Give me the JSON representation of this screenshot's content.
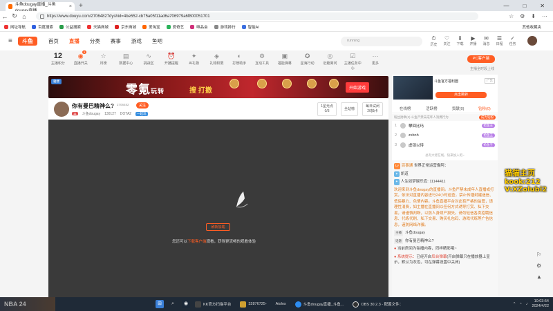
{
  "browser": {
    "tab_title": "斗鱼dougay直播_斗鱼dougay直播...",
    "url": "https://www.douyu.com/27064827dyshid=4be552-cb75a05f11ad6a706979a6f800051701",
    "bookmarks": [
      "网址导航",
      "百度搜索",
      "公益搜索",
      "天猫商城",
      "京东商城",
      "爱淘宝",
      "爱奇艺",
      "唯品会",
      "游戏排行",
      "智能AI"
    ],
    "other_bookmarks": "其他收藏夹"
  },
  "site": {
    "logo": "斗鱼",
    "nav": [
      "首页",
      "直播",
      "分类",
      "赛事",
      "游戏",
      "鱼吧"
    ],
    "search_placeholder": "running",
    "header_icons": [
      "历史",
      "关注",
      "下载",
      "开播",
      "消息",
      "日程",
      "任务"
    ],
    "header_icon_glyphs": [
      "⏱",
      "♡",
      "⬇",
      "▶",
      "✉",
      "☰",
      "✓"
    ]
  },
  "funcbar": {
    "level_num": "12",
    "level_label": "主播积分",
    "items": [
      "直播开关",
      "月榜",
      "数据中心",
      "挑战区",
      "开播提醒",
      "AI礼物",
      "礼物权限",
      "打榜助手",
      "互动工具",
      "福能弹幕",
      "星海行动",
      "近距离问",
      "主播任务中心",
      "更多"
    ],
    "item_glyphs": [
      "◉",
      "☆",
      "▤",
      "∿",
      "⏰",
      "✦",
      "◈",
      "◐",
      "⚙",
      "▣",
      "✪",
      "◎",
      "☑",
      "⋯"
    ],
    "badge": "3",
    "pc_button": "PC客户端",
    "pc_sub": "主播全时段上线"
  },
  "banner": {
    "tag": "雅楼",
    "big": "零氪",
    "mid": "玩转",
    "sub": "搜 打撤",
    "play": "开始游戏"
  },
  "room": {
    "title": "你有曼巴精神么?",
    "room_id": "2706482",
    "follow": "关注",
    "level": "11",
    "anchor": "斗鱼dougay",
    "fans": "130127",
    "game": "DOTA2",
    "category": "一起玩",
    "box1_top": "1星光点",
    "box1_bottom": "0/3",
    "box2": "全站榜",
    "box3_top": "每日试闭",
    "box3_bottom": "20抽卡"
  },
  "video": {
    "error_btn": "刷新加载",
    "tip_prefix": "您还可以",
    "tip_link": "下载客户端",
    "tip_suffix": "观看，获得更流畅的观看体验"
  },
  "sidebar": {
    "promo_title": "斗鱼官方福利圈",
    "promo_ad": "广告",
    "promo_btn": "点击跳转",
    "tabs": [
      "在线榜",
      "活跃榜",
      "贡献(0)",
      "钻粉(0)"
    ],
    "active_tab": 3,
    "rank_header": "粉丝勋章(3)  斗鱼严禁未成年人消费行为",
    "rank_header_btn": "成为钻粉",
    "ranks": [
      {
        "n": "1",
        "name": "攀回比玛",
        "tag": "抢鱼王"
      },
      {
        "n": "2",
        "name": "zxbnh",
        "tag": "抢鱼王"
      },
      {
        "n": "3",
        "name": "虚锁以待",
        "tag": "抢鱼王"
      }
    ],
    "more": "总有大佬在线，快来加入吧~",
    "chat": {
      "welcome_badge": "Lv",
      "welcome_user": "百事通",
      "welcome_text": "世界正常运营像阿：",
      "user2": "凯道",
      "msg3": "人生如梦娱乐应: 11144411",
      "notice": "欢迎来到斗鱼dougay的直播间。斗鱼严禁未成年人直播或打赏，依法对直播内容进行24小时巡查，禁止传播封建迷信、低俗暴力、色情内容。斗鱼直播平台对此有严格的监管，请理性消费，如主播在直播间以任何方式诱导打赏、私下交易，请谨慎判断，以防人身财产损失。请勿轻信各类招聘信息、代练代刷、私下交易、购买礼包码、游戏代练等广告信息，谨防网络诈骗。",
      "host_label": "主播",
      "host_name": "斗鱼dougay",
      "topic_label": "话题",
      "topic": "你有曼巴精神么?",
      "tip1": "当前房间为铂播内容，同样精彩哦~",
      "sys_label": "系统提示：",
      "sys_text": "已经开启",
      "sys_link": "后台弹幕",
      "sys_rest": "(开启弹幕只在播放器上显示，默认为灰色，可在弹幕设置中关闭)"
    }
  },
  "overlay": {
    "l1": "猫猫主页",
    "l2": "kook:212",
    "l3": "V:XZolubi2"
  },
  "taskbar": {
    "apps": [
      "KK官方扫描平台",
      "32876725-",
      "Aiolos",
      "斗鱼dougay直播_斗鱼...",
      "OBS 30.2.3 - 配置文件："
    ],
    "time": "10:03:54",
    "date": "2024/4/22"
  }
}
